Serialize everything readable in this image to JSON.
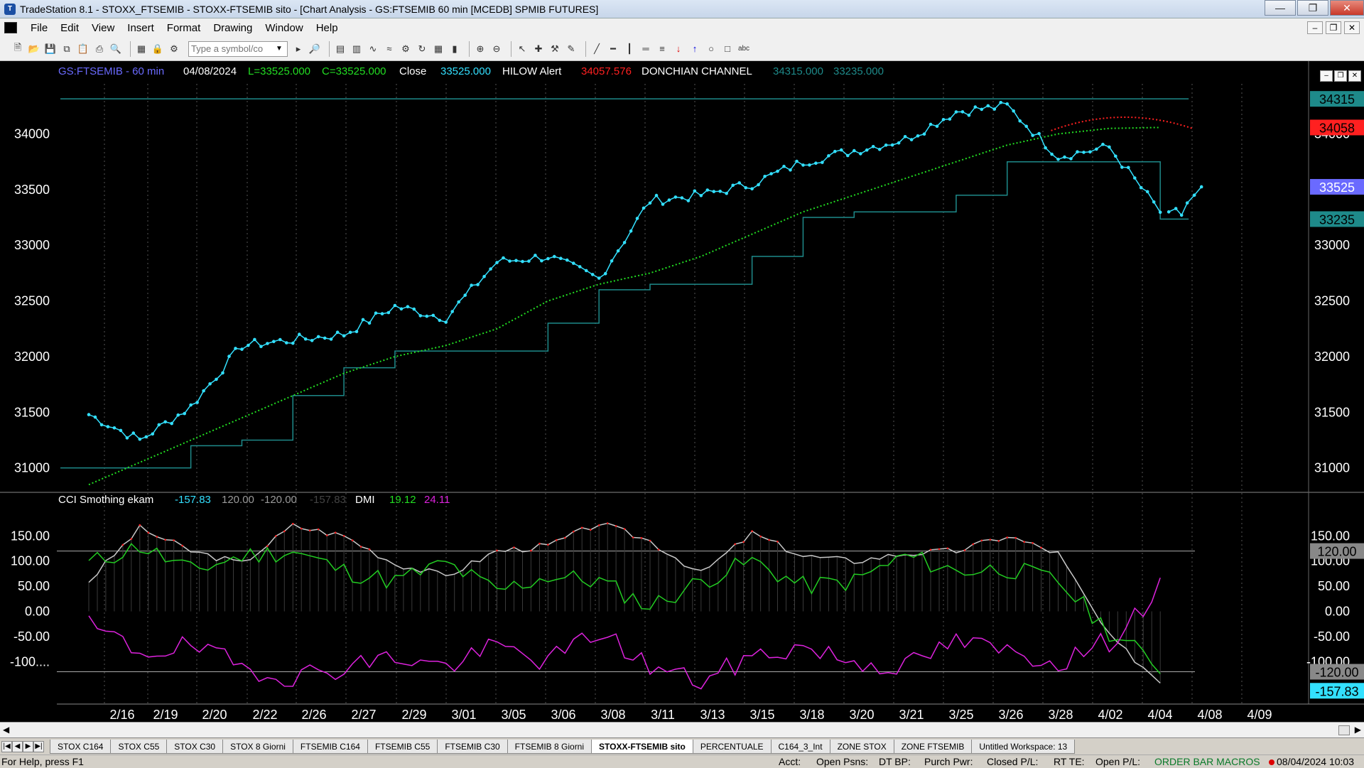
{
  "window": {
    "title": "TradeStation 8.1 - STOXX_FTSEMIB - STOXX-FTSEMIB sito - [Chart Analysis - GS:FTSEMIB  60 min  [MCEDB] SPMIB FUTURES]",
    "minimize": "—",
    "restore": "❐",
    "close": "✕"
  },
  "menu": {
    "items": [
      "File",
      "Edit",
      "View",
      "Insert",
      "Format",
      "Drawing",
      "Window",
      "Help"
    ],
    "mdi": [
      "–",
      "❐",
      "✕"
    ]
  },
  "toolbar": {
    "symbol_placeholder": "Type a symbol/co",
    "icons_left": [
      "new-icon",
      "open-icon",
      "save-icon",
      "copy-icon",
      "paste-icon",
      "print-icon",
      "print-preview-icon"
    ],
    "icons_right": [
      "zoom-in-icon",
      "zoom-out-icon",
      "pointer-icon",
      "trendline-icon",
      "fibonacci-icon",
      "text-icon"
    ]
  },
  "chart": {
    "header": {
      "symbol": "GS:FTSEMIB - 60 min",
      "date": "04/08/2024",
      "low": "L=33525.000",
      "close_eq": "C=33525.000",
      "close_label": "Close",
      "close_value": "33525.000",
      "hilow_label": "HILOW Alert",
      "hilow_value": "34057.576",
      "donchian_label": "DONCHIAN CHANNEL",
      "donchian_upper": "34315.000",
      "donchian_lower": "33235.000"
    },
    "sub_header": {
      "cci_label": "CCI Smothing ekam",
      "cci_value": "-157.83",
      "cci_upper": "120.00",
      "cci_lower": "-120.00",
      "cci_value2": "-157.83",
      "dmi_label": "DMI",
      "dmi_plus": "19.12",
      "dmi_minus": "24.11"
    },
    "price_axis": [
      "34000",
      "33500",
      "33000",
      "32500",
      "32000",
      "31500",
      "31000"
    ],
    "price_markers": {
      "upper": "34315",
      "hilow": "34058",
      "last": "33525",
      "lower": "33235"
    },
    "osc_axis": [
      "150.00",
      "100.00",
      "50.00",
      "0.00",
      "-50.00",
      "-100...."
    ],
    "osc_axis_right": [
      "150.00",
      "100.00",
      "50.00",
      "0.00",
      "-50.00",
      "-100.00"
    ],
    "osc_markers": {
      "upper": "120.00",
      "lower": "-120.00",
      "value": "-157.83"
    },
    "dates": [
      "2/16",
      "2/19",
      "2/20",
      "2/22",
      "2/26",
      "2/27",
      "2/29",
      "3/01",
      "3/05",
      "3/06",
      "3/08",
      "3/11",
      "3/13",
      "3/15",
      "3/18",
      "3/20",
      "3/21",
      "3/25",
      "3/26",
      "3/28",
      "4/02",
      "4/04",
      "4/08",
      "4/09"
    ],
    "colors": {
      "price": "#33e0ff",
      "ma": "#22dd22",
      "donchian": "#1e8a8a",
      "hilow": "#ff2020",
      "cci": "#c8c8c8",
      "cci_hot": "#ff2020",
      "dmi_plus": "#22cc22",
      "dmi_minus": "#dd22dd"
    }
  },
  "chart_data": {
    "type": "line",
    "x": [
      "2/16",
      "2/19",
      "2/20",
      "2/22",
      "2/26",
      "2/27",
      "2/29",
      "3/01",
      "3/05",
      "3/06",
      "3/08",
      "3/11",
      "3/13",
      "3/15",
      "3/18",
      "3/20",
      "3/21",
      "3/25",
      "3/26",
      "3/28",
      "4/02",
      "4/04"
    ],
    "series": [
      {
        "values": [
          31480,
          31250,
          31550,
          32100,
          32150,
          32200,
          32450,
          32350,
          32850,
          32900,
          32700,
          33400,
          33450,
          33550,
          33750,
          33850,
          33950,
          34200,
          34250,
          33800,
          33880,
          33300
        ]
      },
      {
        "values": [
          30850,
          31050,
          31250,
          31450,
          31650,
          31850,
          32000,
          32100,
          32250,
          32500,
          32650,
          32750,
          32900,
          33100,
          33300,
          33450,
          33600,
          33750,
          33900,
          34000,
          34050,
          34058
        ]
      },
      {
        "values": [
          34315,
          34315,
          34315,
          34315,
          34315,
          34315,
          34315,
          34315,
          34315,
          34315,
          34315,
          34315,
          34315,
          34315,
          34315,
          34315,
          34315,
          34315,
          34315,
          34315,
          34315,
          34315
        ]
      },
      {
        "values": [
          31000,
          31000,
          31200,
          31250,
          31650,
          31900,
          32050,
          32050,
          32050,
          32300,
          32600,
          32650,
          32650,
          32900,
          33250,
          33300,
          33300,
          33450,
          33750,
          33750,
          33750,
          33235
        ]
      }
    ],
    "ylim": [
      30800,
      34450
    ]
  }
}
